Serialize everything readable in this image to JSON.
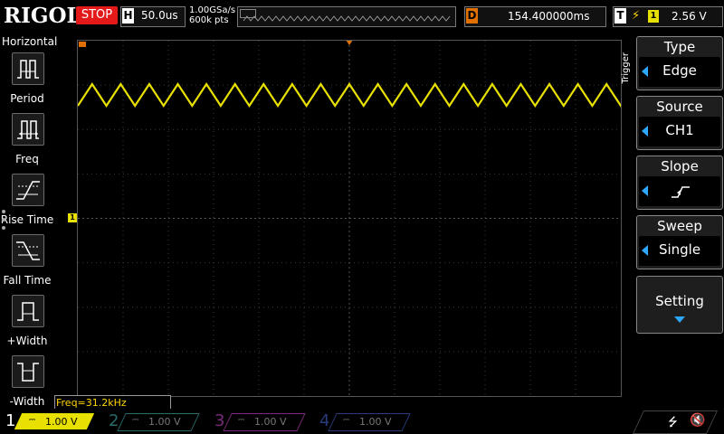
{
  "topbar": {
    "brand": "RIGOL",
    "run_state": "STOP",
    "timebase_key": "H",
    "timebase_value": "50.0us",
    "sample_rate": "1.00GSa/s",
    "memory_depth": "600k pts",
    "delay_key": "D",
    "delay_value": "154.400000ms",
    "trigger_key": "T",
    "trigger_channel": "1",
    "trigger_level": "2.56 V"
  },
  "left_menu": {
    "title": "Horizontal",
    "items": [
      {
        "label": "Period",
        "icon": "period-icon"
      },
      {
        "label": "Freq",
        "icon": "frequency-icon"
      },
      {
        "label": "Rise Time",
        "icon": "rise-time-icon"
      },
      {
        "label": "Fall Time",
        "icon": "fall-time-icon"
      },
      {
        "label": "+Width",
        "icon": "positive-width-icon"
      },
      {
        "label": "-Width",
        "icon": "negative-width-icon"
      }
    ]
  },
  "measurement": {
    "freq_readout": "Freq=31.2kHz"
  },
  "right_menu": {
    "section_label": "Trigger",
    "keys": [
      {
        "title": "Type",
        "value": "Edge"
      },
      {
        "title": "Source",
        "value": "CH1"
      },
      {
        "title": "Slope",
        "value": "",
        "icon": "rising-edge-icon"
      },
      {
        "title": "Sweep",
        "value": "Single"
      },
      {
        "title": "Setting",
        "value": ""
      }
    ]
  },
  "waveform": {
    "channel": "1",
    "color": "#e8e000",
    "shape": "triangle",
    "cycles_visible": 19
  },
  "channels": [
    {
      "num": "1",
      "scale": "1.00 V",
      "color": "#e8e000",
      "active": true
    },
    {
      "num": "2",
      "scale": "1.00 V",
      "color": "#2a6a6a",
      "active": false
    },
    {
      "num": "3",
      "scale": "1.00 V",
      "color": "#7a2a7a",
      "active": false
    },
    {
      "num": "4",
      "scale": "1.00 V",
      "color": "#2a3a7a",
      "active": false
    }
  ],
  "status_icons": [
    "usb-icon",
    "speaker-mute-icon"
  ]
}
